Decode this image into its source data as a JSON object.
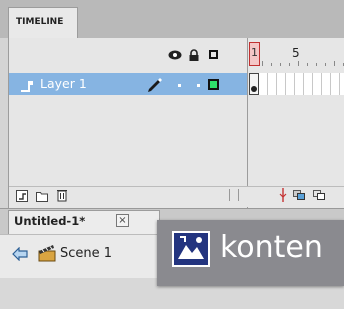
{
  "timeline": {
    "tab_label": "TIMELINE",
    "frame_number_1": "1",
    "frame_number_5": "5",
    "layer_name": "Layer 1"
  },
  "document": {
    "tab_title": "Untitled-1*",
    "close_glyph": "×"
  },
  "scene": {
    "label": "Scene 1"
  },
  "overlay": {
    "text": "konten"
  },
  "colors": {
    "layer_selected": "#86b4e2",
    "playhead": "#c53333",
    "outline_square": "#2ee06b"
  }
}
